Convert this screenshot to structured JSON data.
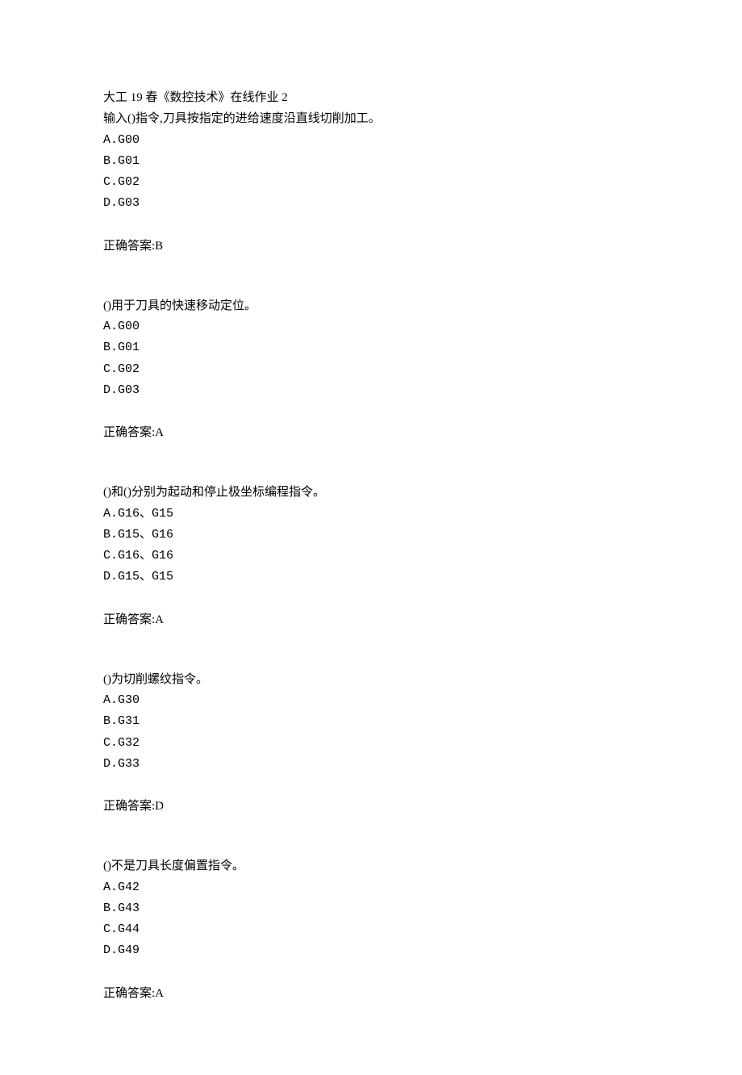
{
  "title": "大工 19 春《数控技术》在线作业 2",
  "questions": [
    {
      "stem": "输入()指令,刀具按指定的进给速度沿直线切削加工。",
      "options": [
        "A.G00",
        "B.G01",
        "C.G02",
        "D.G03"
      ],
      "answer": "正确答案:B"
    },
    {
      "stem": "()用于刀具的快速移动定位。",
      "options": [
        "A.G00",
        "B.G01",
        "C.G02",
        "D.G03"
      ],
      "answer": "正确答案:A"
    },
    {
      "stem": "()和()分别为起动和停止极坐标编程指令。",
      "options": [
        "A.G16、G15",
        "B.G15、G16",
        "C.G16、G16",
        "D.G15、G15"
      ],
      "answer": "正确答案:A"
    },
    {
      "stem": "()为切削螺纹指令。",
      "options": [
        "A.G30",
        "B.G31",
        "C.G32",
        "D.G33"
      ],
      "answer": "正确答案:D"
    },
    {
      "stem": "()不是刀具长度偏置指令。",
      "options": [
        "A.G42",
        "B.G43",
        "C.G44",
        "D.G49"
      ],
      "answer": "正确答案:A"
    }
  ]
}
